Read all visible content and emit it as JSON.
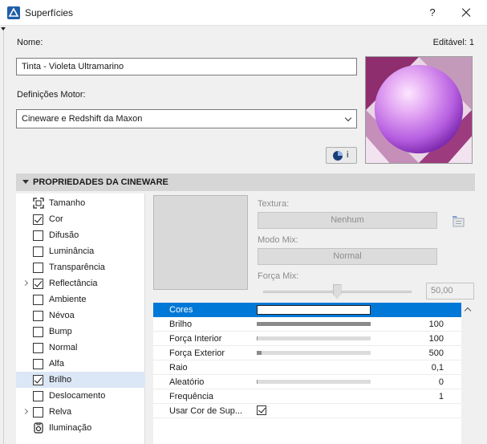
{
  "window": {
    "title": "Superfícies",
    "help": "?"
  },
  "form": {
    "name_label": "Nome:",
    "editable_label": "Editável: 1",
    "name_value": "Tinta - Violeta Ultramarino",
    "engine_label": "Definições Motor:",
    "engine_value": "Cineware e Redshift da Maxon",
    "info_button": "i"
  },
  "section": {
    "title": "PROPRIEDADES DA CINEWARE"
  },
  "channels": [
    {
      "label": "Tamanho",
      "kind": "size",
      "checked": false,
      "expandable": false,
      "selected": false
    },
    {
      "label": "Cor",
      "kind": "checkbox",
      "checked": true,
      "expandable": false,
      "selected": false
    },
    {
      "label": "Difusão",
      "kind": "checkbox",
      "checked": false,
      "expandable": false,
      "selected": false
    },
    {
      "label": "Luminância",
      "kind": "checkbox",
      "checked": false,
      "expandable": false,
      "selected": false
    },
    {
      "label": "Transparência",
      "kind": "checkbox",
      "checked": false,
      "expandable": false,
      "selected": false
    },
    {
      "label": "Reflectância",
      "kind": "checkbox",
      "checked": true,
      "expandable": true,
      "selected": false
    },
    {
      "label": "Ambiente",
      "kind": "checkbox",
      "checked": false,
      "expandable": false,
      "selected": false
    },
    {
      "label": "Névoa",
      "kind": "checkbox",
      "checked": false,
      "expandable": false,
      "selected": false
    },
    {
      "label": "Bump",
      "kind": "checkbox",
      "checked": false,
      "expandable": false,
      "selected": false
    },
    {
      "label": "Normal",
      "kind": "checkbox",
      "checked": false,
      "expandable": false,
      "selected": false
    },
    {
      "label": "Alfa",
      "kind": "checkbox",
      "checked": false,
      "expandable": false,
      "selected": false
    },
    {
      "label": "Brilho",
      "kind": "checkbox",
      "checked": true,
      "expandable": false,
      "selected": true
    },
    {
      "label": "Deslocamento",
      "kind": "checkbox",
      "checked": false,
      "expandable": false,
      "selected": false
    },
    {
      "label": "Relva",
      "kind": "checkbox",
      "checked": false,
      "expandable": true,
      "selected": false
    },
    {
      "label": "Iluminação",
      "kind": "light",
      "checked": false,
      "expandable": false,
      "selected": false
    }
  ],
  "texture": {
    "texture_label": "Textura:",
    "texture_value": "Nenhum",
    "mix_mode_label": "Modo Mix:",
    "mix_mode_value": "Normal",
    "mix_strength_label": "Força Mix:",
    "mix_strength_value": "50,00",
    "mix_strength_fraction": 0.5
  },
  "properties": [
    {
      "name": "Cores",
      "type": "color",
      "color": "#ffffff",
      "selected": true
    },
    {
      "name": "Brilho",
      "type": "slider",
      "fraction": 1.0,
      "value": "100"
    },
    {
      "name": "Força Interior",
      "type": "slider",
      "fraction": 0.01,
      "value": "100"
    },
    {
      "name": "Força Exterior",
      "type": "slider",
      "fraction": 0.04,
      "value": "500"
    },
    {
      "name": "Raio",
      "type": "value",
      "value": "0,1"
    },
    {
      "name": "Aleatório",
      "type": "slider",
      "fraction": 0.0,
      "value": "0"
    },
    {
      "name": "Frequência",
      "type": "value",
      "value": "1"
    },
    {
      "name": "Usar Cor de Sup...",
      "type": "checkbox",
      "checked": true
    }
  ],
  "colors": {
    "accent": "#0078d7",
    "selection": "#dbe7f6",
    "sphere": "#c98ae6"
  }
}
